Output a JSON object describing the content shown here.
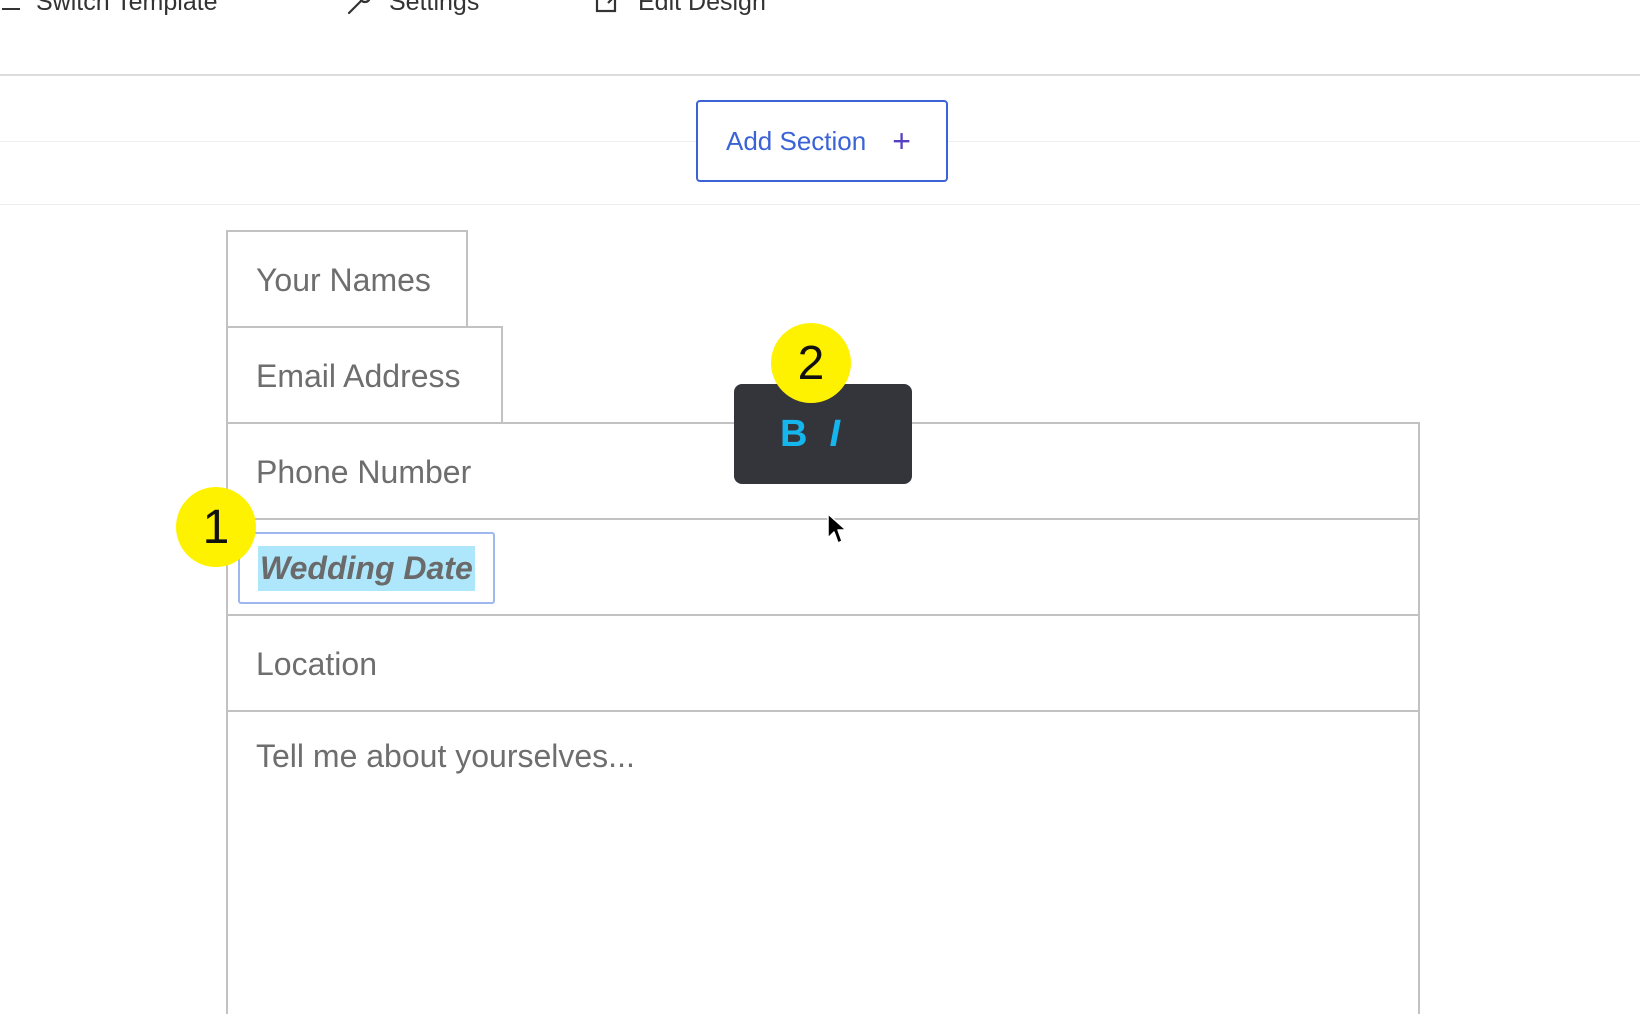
{
  "toolbar": {
    "switch_template": "Switch Template",
    "settings": "Settings",
    "edit_design": "Edit Design"
  },
  "add_section": {
    "label": "Add Section",
    "icon": "+"
  },
  "form": {
    "names_placeholder": "Your Names",
    "email_placeholder": "Email Address",
    "phone_placeholder": "Phone Number",
    "date_value": "Wedding Date",
    "location_placeholder": "Location",
    "about_placeholder": "Tell me about yourselves..."
  },
  "format_popup": {
    "bold": "B",
    "italic": "I"
  },
  "markers": {
    "first": "1",
    "second": "2"
  },
  "colors": {
    "accent_blue": "#3b63d6",
    "marker_yellow": "#fef200",
    "selection": "#aee6fb",
    "popup_bg": "#34353a",
    "format_icon": "#15b6ee"
  }
}
